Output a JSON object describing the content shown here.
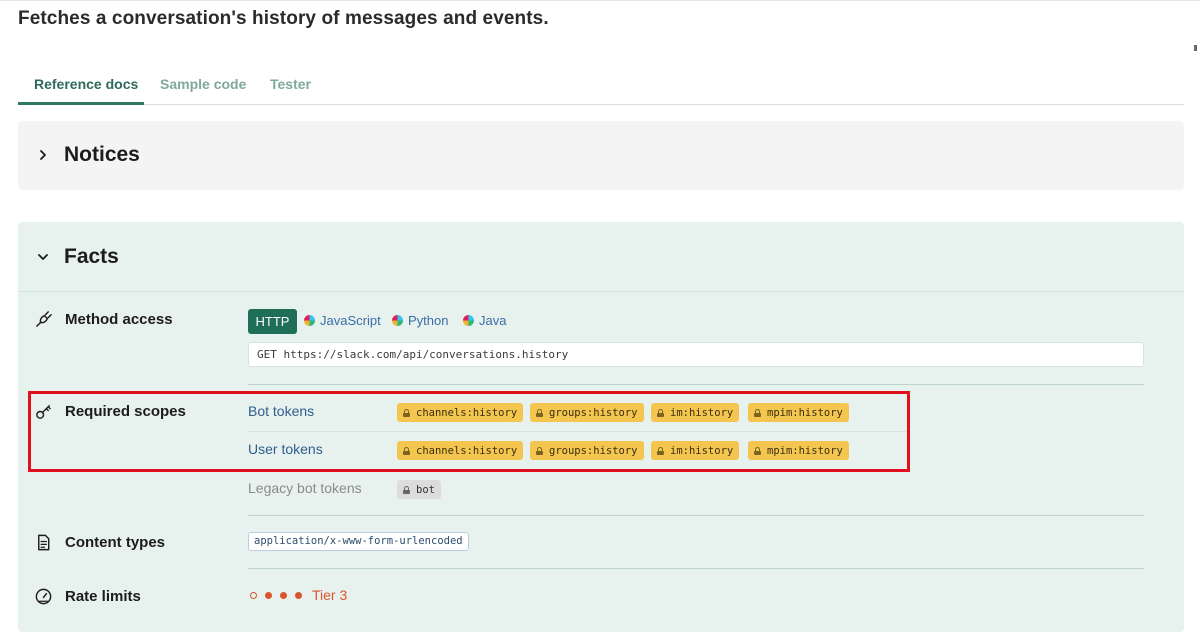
{
  "page": {
    "title": "Fetches a conversation's history of messages and events."
  },
  "tabs": [
    {
      "label": "Reference docs",
      "active": true
    },
    {
      "label": "Sample code",
      "active": false
    },
    {
      "label": "Tester",
      "active": false
    }
  ],
  "notices": {
    "heading": "Notices",
    "icon": "chevron-right-icon"
  },
  "facts": {
    "heading": "Facts",
    "icon": "chevron-down-icon",
    "method_access": {
      "label": "Method access",
      "icon": "plug-icon",
      "http_label": "HTTP",
      "languages": [
        "JavaScript",
        "Python",
        "Java"
      ],
      "endpoint": "GET  https://slack.com/api/conversations.history"
    },
    "required_scopes": {
      "label": "Required scopes",
      "icon": "key-icon",
      "bot_tokens": {
        "label": "Bot tokens",
        "scopes": [
          "channels:history",
          "groups:history",
          "im:history",
          "mpim:history"
        ]
      },
      "user_tokens": {
        "label": "User tokens",
        "scopes": [
          "channels:history",
          "groups:history",
          "im:history",
          "mpim:history"
        ]
      },
      "legacy_bot_tokens": {
        "label": "Legacy bot tokens",
        "scopes": [
          "bot"
        ]
      }
    },
    "content_types": {
      "label": "Content types",
      "icon": "document-icon",
      "value": "application/x-www-form-urlencoded"
    },
    "rate_limits": {
      "label": "Rate limits",
      "icon": "gauge-icon",
      "tier": "Tier 3",
      "tier_filled": 3,
      "tier_total": 4
    }
  },
  "colors": {
    "accent": "#1f6e57",
    "scope_badge": "#f4c64f",
    "rate_limit": "#d9552e",
    "highlight_box": "#e0101c"
  }
}
